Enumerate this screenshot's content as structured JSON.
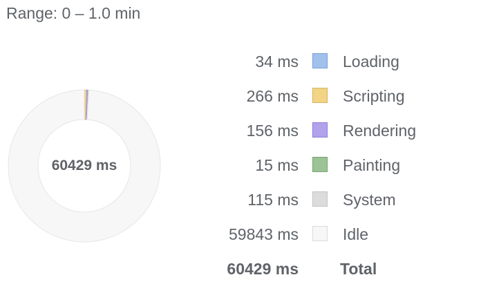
{
  "range_label": "Range: 0 – 1.0 min",
  "total": {
    "value": "60429 ms",
    "label": "Total",
    "ms": 60429
  },
  "categories": [
    {
      "label": "Loading",
      "value": "34 ms",
      "ms": 34,
      "color": "#a1c1ec",
      "border": "#7b9fd6"
    },
    {
      "label": "Scripting",
      "value": "266 ms",
      "ms": 266,
      "color": "#f3d386",
      "border": "#d6b25c"
    },
    {
      "label": "Rendering",
      "value": "156 ms",
      "ms": 156,
      "color": "#b2a2ec",
      "border": "#8f7ad6"
    },
    {
      "label": "Painting",
      "value": "15 ms",
      "ms": 15,
      "color": "#9bc395",
      "border": "#73a66b"
    },
    {
      "label": "System",
      "value": "115 ms",
      "ms": 115,
      "color": "#dcdcdc",
      "border": "#c4c4c4"
    },
    {
      "label": "Idle",
      "value": "59843 ms",
      "ms": 59843,
      "color": "#f7f7f7",
      "border": "#dcdcdc"
    }
  ]
}
